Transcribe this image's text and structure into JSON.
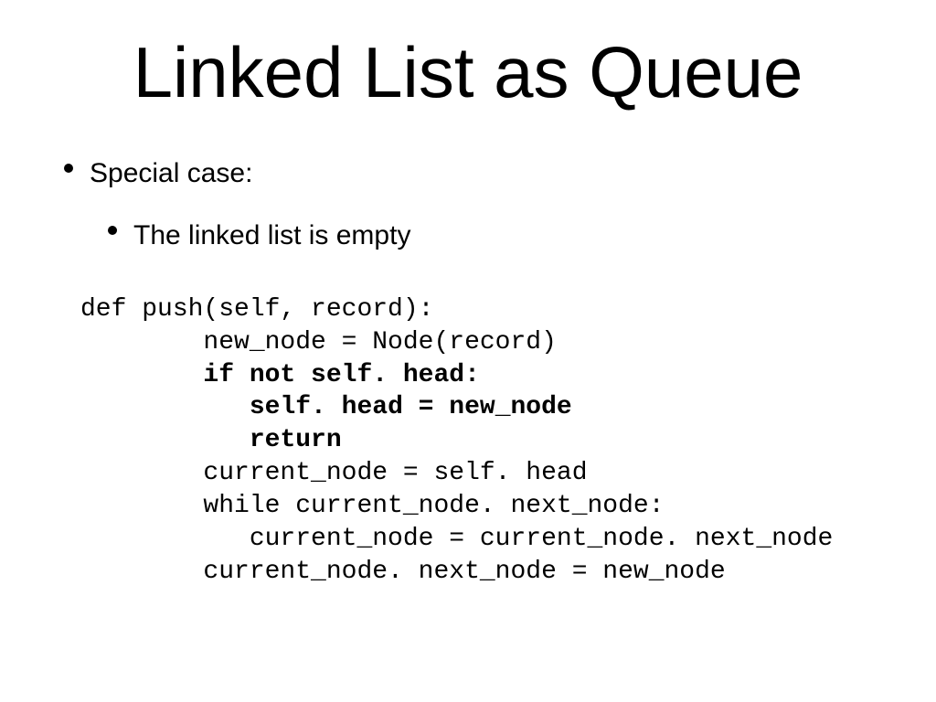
{
  "title": "Linked List as Queue",
  "bullets": {
    "level1": "Special case:",
    "level2": "The linked list is empty"
  },
  "code": {
    "l1": "def push(self, record):",
    "l2": "        new_node = Node(record)",
    "l3a": "        ",
    "l3b": "if not self. head:",
    "l4a": "           ",
    "l4b": "self. head = new_node",
    "l5a": "           ",
    "l5b": "return",
    "l6": "        current_node = self. head",
    "l7": "        while current_node. next_node:",
    "l8": "           current_node = current_node. next_node",
    "l9": "        current_node. next_node = new_node"
  }
}
